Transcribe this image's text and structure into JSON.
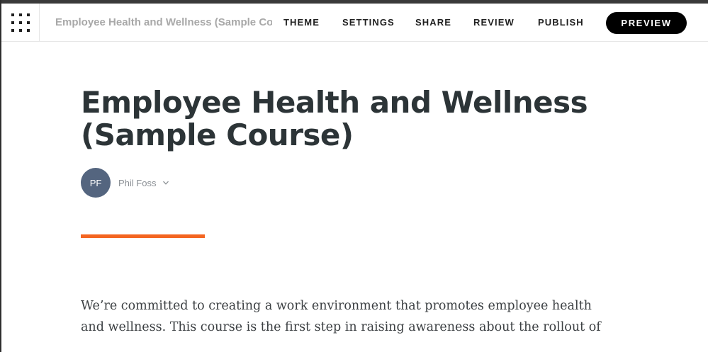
{
  "header": {
    "menu_icon": "grid-menu-icon",
    "course_title": "Employee Health and Wellness (Sample Course)",
    "nav": {
      "theme": "THEME",
      "settings": "SETTINGS",
      "share": "SHARE",
      "review": "REVIEW",
      "publish": "PUBLISH"
    },
    "preview_label": "PREVIEW"
  },
  "course": {
    "title": "Employee Health and Wellness (Sample Course)",
    "author": {
      "initials": "PF",
      "name": "Phil Foss",
      "dropdown_icon": "chevron-down-icon"
    },
    "intro_line1": "We’re committed to creating a work environment that promotes employee health",
    "intro_line2": "and wellness. This course is the first step in raising awareness about the rollout of"
  },
  "colors": {
    "accent": "#f46521",
    "avatar_bg": "#54657f",
    "title_text": "#2c3437",
    "preview_bg": "#000000"
  }
}
